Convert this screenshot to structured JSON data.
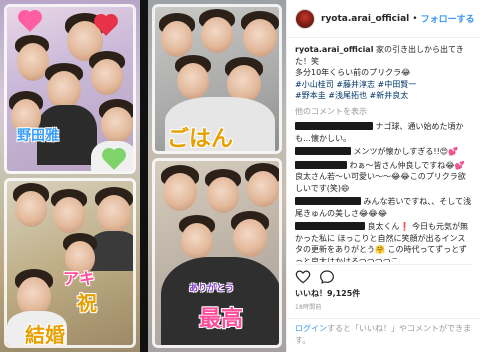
{
  "post": {
    "username": "ryota.arai_official",
    "separator": "•",
    "follow_label": "フォローする",
    "caption_lines": [
      "家の引き出しから出てきた！笑",
      "多分10年くらい前のプリクラ😂"
    ],
    "hashtags_line1": "#小山桂司 #藤井淳志 #中田賢一",
    "hashtags_line2": "#野本圭 #浅尾拓也 #新井良太",
    "more_comments": "他のコメントを表示",
    "comments": [
      {
        "text": "ナゴ球、通い始めた頃かも…懐かしい。"
      },
      {
        "text": "メンツが懐かしすぎる!!😍💕"
      },
      {
        "text": "わぁ〜皆さん仲良しですね😂💕良太さん若〜い可愛い〜〜😂😂このプリクラ欲しいです(笑)😄"
      },
      {
        "text": "みんな若いですね、、そして浅尾きゅんの美しさ😂😂😂"
      },
      {
        "text": "良太くん❗ 今日も元気が無かった私に ほっこりと自然に笑顔が出るインスタの更新をありがとう🤗 この時代ってずっとずっと良太はかけるつつつつこ"
      }
    ],
    "likes": "いいね！9,125件",
    "time": "18時間前",
    "login_link": "ログイン",
    "login_text": "すると「いいね！」やコメントができます。"
  },
  "photo": {
    "sticker_left_top": "野田雅",
    "sticker_left_mid": "アキ",
    "sticker_left_mid2": "祝",
    "sticker_left_bottom": "結婚",
    "sticker_right_top": "ごはん",
    "sticker_right_bottom": "最高",
    "sticker_right_bottom_small": "ありがとう"
  },
  "colors": {
    "accent": "#3897f0",
    "heart_pink": "#ff5fa0",
    "heart_red": "#e8324a",
    "sticker_pink": "#ff4f9a",
    "sticker_gold": "#e8a000",
    "sticker_purple": "#8a3fd1"
  },
  "icons": [
    "heart-outline-icon",
    "comment-bubble-icon"
  ]
}
